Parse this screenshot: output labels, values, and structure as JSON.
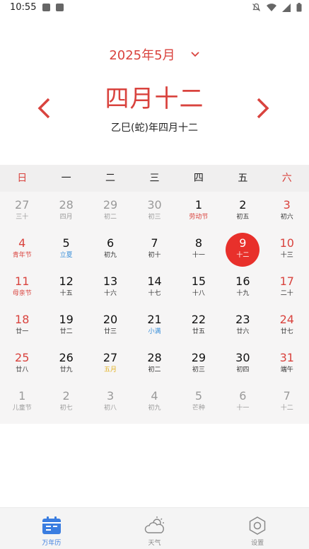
{
  "status": {
    "time": "10:55"
  },
  "header": {
    "month_label": "2025年5月",
    "big_date": "四月十二",
    "lunar_full": "乙巳(蛇)年四月十二"
  },
  "weekdays": [
    "日",
    "一",
    "二",
    "三",
    "四",
    "五",
    "六"
  ],
  "days": [
    {
      "n": "27",
      "s": "三十",
      "kind": "other"
    },
    {
      "n": "28",
      "s": "四月",
      "kind": "other"
    },
    {
      "n": "29",
      "s": "初二",
      "kind": "other"
    },
    {
      "n": "30",
      "s": "初三",
      "kind": "other"
    },
    {
      "n": "1",
      "s": "劳动节",
      "kind": "weekday",
      "sub": "festival"
    },
    {
      "n": "2",
      "s": "初五",
      "kind": "weekday"
    },
    {
      "n": "3",
      "s": "初六",
      "kind": "weekend"
    },
    {
      "n": "4",
      "s": "青年节",
      "kind": "weekend",
      "sub": "festival"
    },
    {
      "n": "5",
      "s": "立夏",
      "kind": "weekday",
      "sub": "term"
    },
    {
      "n": "6",
      "s": "初九",
      "kind": "weekday"
    },
    {
      "n": "7",
      "s": "初十",
      "kind": "weekday"
    },
    {
      "n": "8",
      "s": "十一",
      "kind": "weekday"
    },
    {
      "n": "9",
      "s": "十二",
      "kind": "weekday",
      "selected": true
    },
    {
      "n": "10",
      "s": "十三",
      "kind": "weekend"
    },
    {
      "n": "11",
      "s": "母亲节",
      "kind": "weekend",
      "sub": "festival"
    },
    {
      "n": "12",
      "s": "十五",
      "kind": "weekday"
    },
    {
      "n": "13",
      "s": "十六",
      "kind": "weekday"
    },
    {
      "n": "14",
      "s": "十七",
      "kind": "weekday"
    },
    {
      "n": "15",
      "s": "十八",
      "kind": "weekday"
    },
    {
      "n": "16",
      "s": "十九",
      "kind": "weekday"
    },
    {
      "n": "17",
      "s": "二十",
      "kind": "weekend"
    },
    {
      "n": "18",
      "s": "廿一",
      "kind": "weekend"
    },
    {
      "n": "19",
      "s": "廿二",
      "kind": "weekday"
    },
    {
      "n": "20",
      "s": "廿三",
      "kind": "weekday"
    },
    {
      "n": "21",
      "s": "小满",
      "kind": "weekday",
      "sub": "term"
    },
    {
      "n": "22",
      "s": "廿五",
      "kind": "weekday"
    },
    {
      "n": "23",
      "s": "廿六",
      "kind": "weekday"
    },
    {
      "n": "24",
      "s": "廿七",
      "kind": "weekend"
    },
    {
      "n": "25",
      "s": "廿八",
      "kind": "weekend"
    },
    {
      "n": "26",
      "s": "廿九",
      "kind": "weekday"
    },
    {
      "n": "27",
      "s": "五月",
      "kind": "weekday",
      "sub": "yellow"
    },
    {
      "n": "28",
      "s": "初二",
      "kind": "weekday"
    },
    {
      "n": "29",
      "s": "初三",
      "kind": "weekday"
    },
    {
      "n": "30",
      "s": "初四",
      "kind": "weekday"
    },
    {
      "n": "31",
      "s": "端午",
      "kind": "weekend"
    },
    {
      "n": "1",
      "s": "儿童节",
      "kind": "other"
    },
    {
      "n": "2",
      "s": "初七",
      "kind": "other"
    },
    {
      "n": "3",
      "s": "初八",
      "kind": "other"
    },
    {
      "n": "4",
      "s": "初九",
      "kind": "other"
    },
    {
      "n": "5",
      "s": "芒种",
      "kind": "other"
    },
    {
      "n": "6",
      "s": "十一",
      "kind": "other"
    },
    {
      "n": "7",
      "s": "十二",
      "kind": "other"
    }
  ],
  "tabs": [
    {
      "label": "万年历",
      "icon": "calendar-icon",
      "active": true
    },
    {
      "label": "天气",
      "icon": "weather-icon",
      "active": false
    },
    {
      "label": "设置",
      "icon": "settings-icon",
      "active": false
    }
  ],
  "colors": {
    "accent": "#d9433e",
    "selected": "#e8302b",
    "tab_active": "#3a7de0",
    "term": "#3a8fd9"
  }
}
